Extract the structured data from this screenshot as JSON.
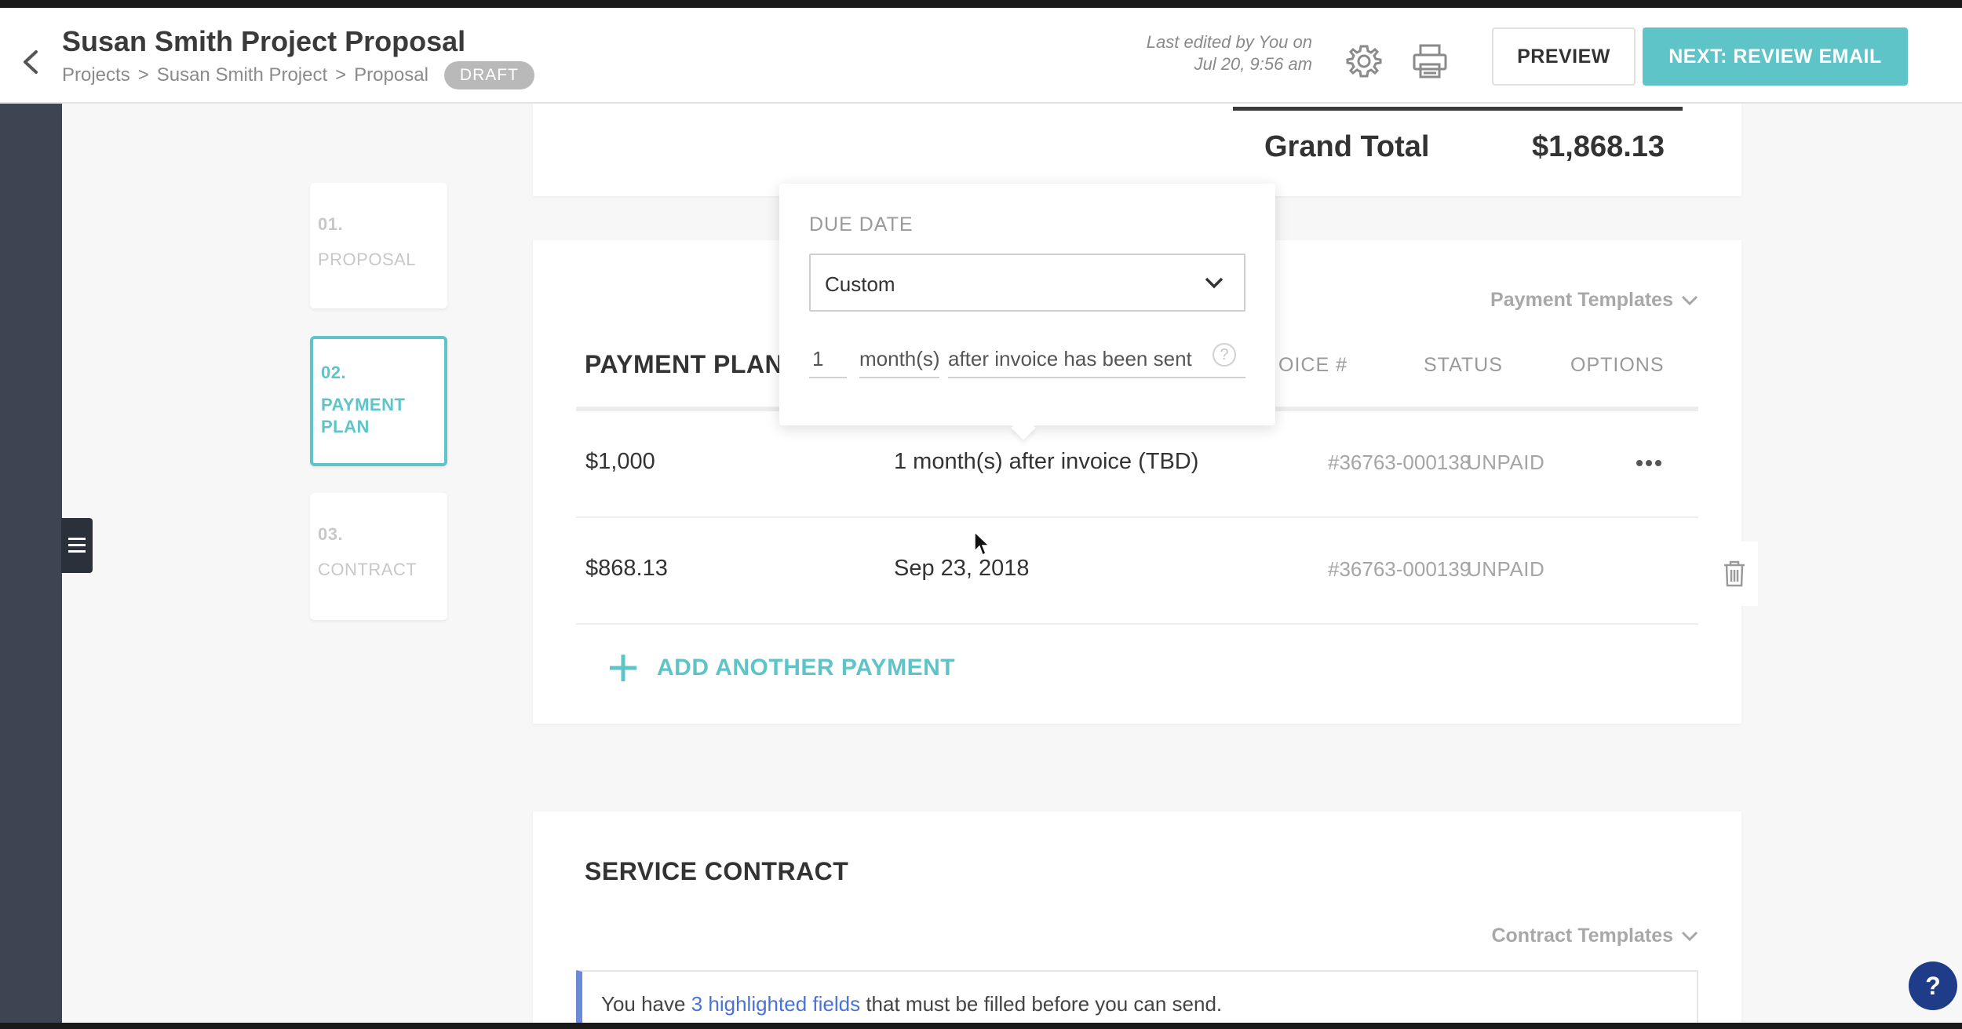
{
  "header": {
    "title": "Susan Smith Project Proposal",
    "breadcrumb": [
      "Projects",
      "Susan Smith Project",
      "Proposal"
    ],
    "breadcrumb_separator": ">",
    "status_badge": "DRAFT",
    "last_edited_line1": "Last edited by You on",
    "last_edited_line2": "Jul 20, 9:56 am",
    "preview_label": "PREVIEW",
    "next_label": "NEXT: REVIEW EMAIL",
    "accent_color": "#5ec4c8"
  },
  "steps": [
    {
      "num": "01.",
      "label": "PROPOSAL",
      "active": false
    },
    {
      "num": "02.",
      "label": "PAYMENT PLAN",
      "active": true
    },
    {
      "num": "03.",
      "label": "CONTRACT",
      "active": false
    }
  ],
  "totals": {
    "grand_total_label": "Grand Total",
    "grand_total_value": "$1,868.13"
  },
  "payment_plan": {
    "title": "PAYMENT PLAN",
    "templates_label": "Payment Templates",
    "columns": {
      "invoice": "OICE #",
      "status": "STATUS",
      "options": "OPTIONS"
    },
    "rows": [
      {
        "amount": "$1,000",
        "due": "1  month(s)  after invoice (TBD)",
        "invoice": "#36763-000138",
        "status": "UNPAID"
      },
      {
        "amount": "$868.13",
        "due": "Sep 23, 2018",
        "invoice": "#36763-000139",
        "status": "UNPAID"
      }
    ],
    "add_label": "ADD ANOTHER PAYMENT"
  },
  "due_date_popover": {
    "label": "DUE DATE",
    "select_value": "Custom",
    "count_value": "1",
    "unit_value": "month(s)",
    "after_value": "after invoice has been sent",
    "help_glyph": "?"
  },
  "contract": {
    "title": "SERVICE CONTRACT",
    "templates_label": "Contract Templates",
    "notice_prefix": "You have ",
    "notice_link": "3 highlighted fields",
    "notice_suffix": " that must be filled before you can send."
  },
  "help_button": "?"
}
